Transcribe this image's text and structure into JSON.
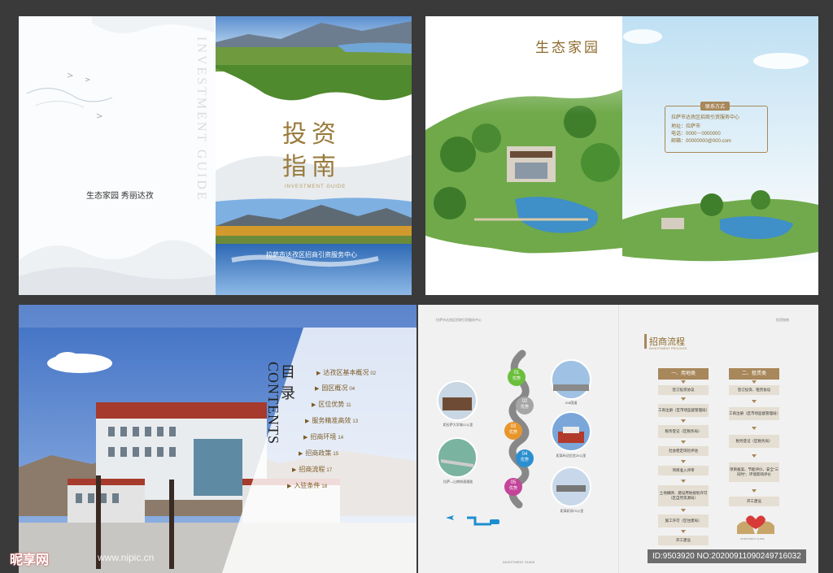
{
  "cover": {
    "vertical_en": "INVESTMENT GUIDE",
    "tagline": "生态家园 秀丽达孜",
    "title_line1": "投资",
    "title_line2": "指南",
    "title_en": "INVESTMENT GUIDE",
    "bottom_caption": "拉萨市达孜区招商引资服务中心"
  },
  "eco": {
    "title": "生态家园",
    "contact_badge": "联系方式",
    "contact_org": "拉萨市达孜区招商引资服务中心",
    "contact_addr": "地址：拉萨市",
    "contact_phone": "电话：0000－0000000",
    "contact_email": "邮箱：00000000@000.com"
  },
  "toc": {
    "mulu_1": "目",
    "mulu_2": "录",
    "contents_en": "CONTENTS",
    "items": [
      {
        "label": "达孜区基本概况",
        "page": "02"
      },
      {
        "label": "园区概况",
        "page": "04"
      },
      {
        "label": "区位优势",
        "page": "11"
      },
      {
        "label": "服务精准高效",
        "page": "13"
      },
      {
        "label": "招商环境",
        "page": "14"
      },
      {
        "label": "招商政策",
        "page": "15"
      },
      {
        "label": "招商流程",
        "page": "17"
      },
      {
        "label": "入驻条件",
        "page": "18"
      }
    ]
  },
  "process": {
    "left_header": "拉萨市达孜区招商引资服务中心",
    "right_header": "投资指南",
    "advantage_label": "优势",
    "steps": [
      {
        "num": "01",
        "caption": "318国道"
      },
      {
        "num": "02",
        "caption": "距拉萨大学城12公里"
      },
      {
        "num": "03",
        "caption": "距离布达拉宫20公里"
      },
      {
        "num": "04",
        "caption": "拉萨—山南快速通道"
      },
      {
        "num": "05",
        "caption": "距离机场70公里"
      }
    ],
    "flow_title": "招商流程",
    "flow_title_en": "INVESTMENT PROCESS",
    "col1_head": "一、用地类",
    "col2_head": "二、租赁类",
    "col1_steps": [
      "签订投资协议",
      "工商注册（区市场监督管理局）",
      "税务登记（区税务局）",
      "社会稳定风险评估",
      "项目准入评审",
      "土地摘牌、建设用地规划许可（区自然资源局）",
      "施工许可（区住建局）",
      "开工建设"
    ],
    "col2_steps": [
      "签订投资、租赁协议",
      "工商注册（区市场监督管理局）",
      "税务登记（区税务局）",
      "项目备案、节能评价、安全“三同时”、环境影响评价",
      "开工建设"
    ],
    "footer_mark": "INVESTMENT GUIDE"
  },
  "watermark": {
    "logo": "昵享网",
    "url": "www.nipic.cn",
    "id": "ID:9503920 NO:20200911090249716032"
  }
}
